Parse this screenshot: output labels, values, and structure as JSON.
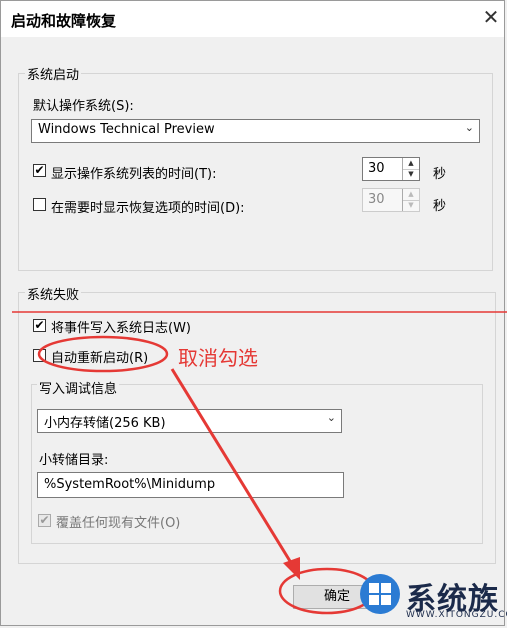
{
  "window": {
    "title": "启动和故障恢复",
    "close_glyph": "✕"
  },
  "system_startup": {
    "legend": "系统启动",
    "default_os_label": "默认操作系统(S):",
    "default_os_value": "Windows Technical Preview",
    "show_os_list": {
      "label": "显示操作系统列表的时间(T):",
      "checked": true,
      "value": "30",
      "unit": "秒"
    },
    "show_recovery": {
      "label": "在需要时显示恢复选项的时间(D):",
      "checked": false,
      "value": "30",
      "unit": "秒"
    }
  },
  "system_failure": {
    "legend": "系统失败",
    "write_event": {
      "label": "将事件写入系统日志(W)",
      "checked": true
    },
    "auto_restart": {
      "label": "自动重新启动(R)",
      "checked": false
    },
    "debug": {
      "legend": "写入调试信息",
      "dump_type": "小内存转储(256 KB)",
      "dump_dir_label": "小转储目录:",
      "dump_dir_value": "%SystemRoot%\\Minidump",
      "overwrite": {
        "label": "覆盖任何现有文件(O)",
        "checked": true
      }
    }
  },
  "buttons": {
    "ok": "确定"
  },
  "annotation": {
    "text": "取消勾选",
    "color": "#e53935"
  },
  "watermark": {
    "brand": "系统族",
    "url": "WWW.XITONGZU.COM"
  },
  "glyphs": {
    "check": "✔",
    "chevron": "⌄",
    "up": "▲",
    "down": "▼"
  }
}
